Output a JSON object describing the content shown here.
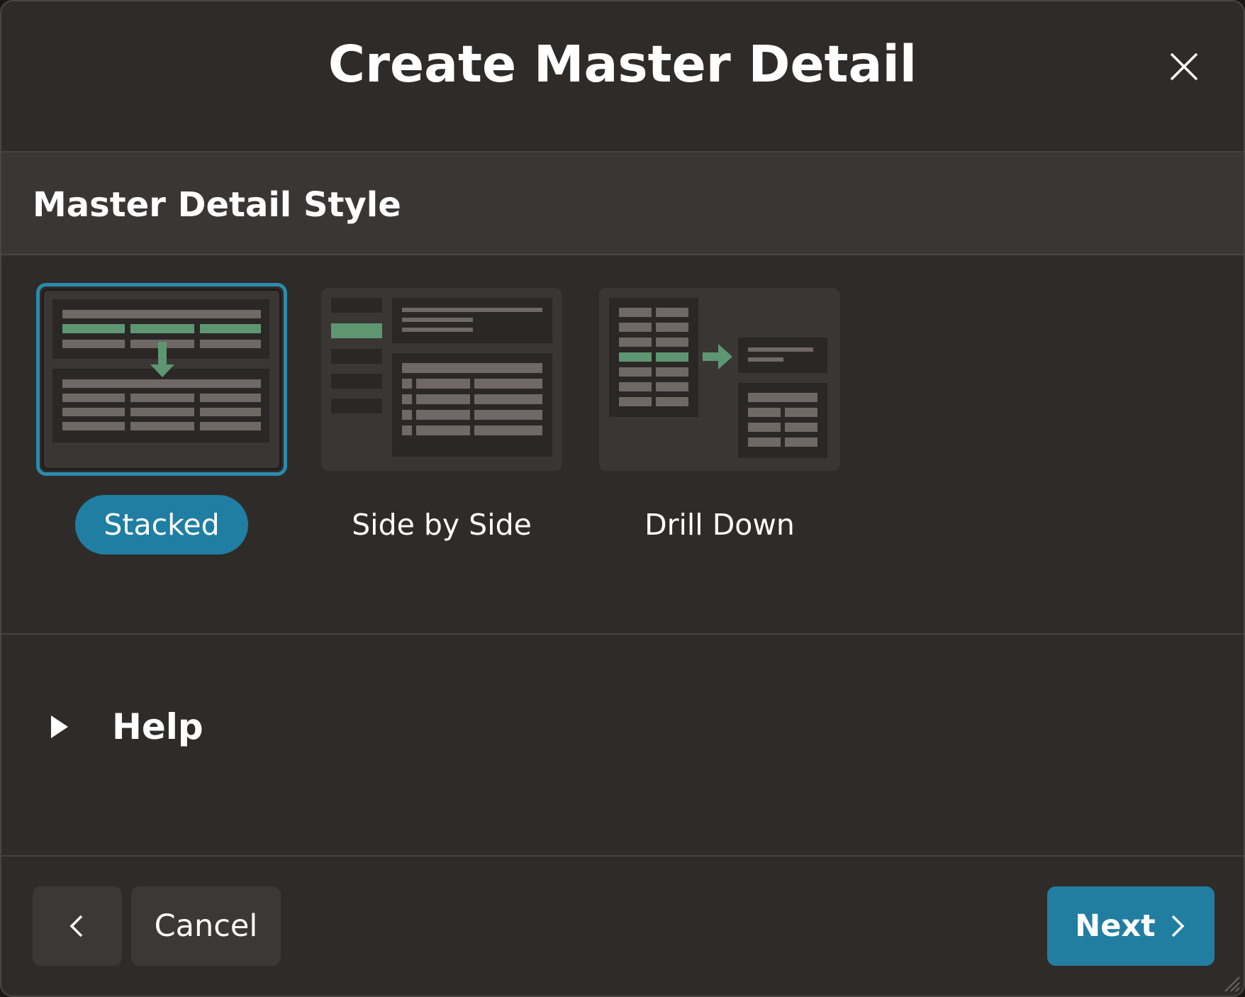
{
  "dialog": {
    "title": "Create Master Detail",
    "close_icon": "close-icon"
  },
  "region": {
    "title": "Master Detail Style"
  },
  "styles": {
    "selected": "Stacked",
    "options": [
      {
        "label": "Stacked",
        "icon": "stacked-layout-icon"
      },
      {
        "label": "Side by Side",
        "icon": "side-by-side-layout-icon"
      },
      {
        "label": "Drill Down",
        "icon": "drill-down-layout-icon"
      }
    ]
  },
  "help": {
    "label": "Help",
    "icon": "caret-right-icon"
  },
  "footer": {
    "back_icon": "chevron-left-icon",
    "cancel_label": "Cancel",
    "next_label": "Next",
    "next_icon": "chevron-right-icon"
  },
  "colors": {
    "accent": "#217ea1",
    "highlight_row": "#5e9672",
    "background": "#2f2b29"
  }
}
